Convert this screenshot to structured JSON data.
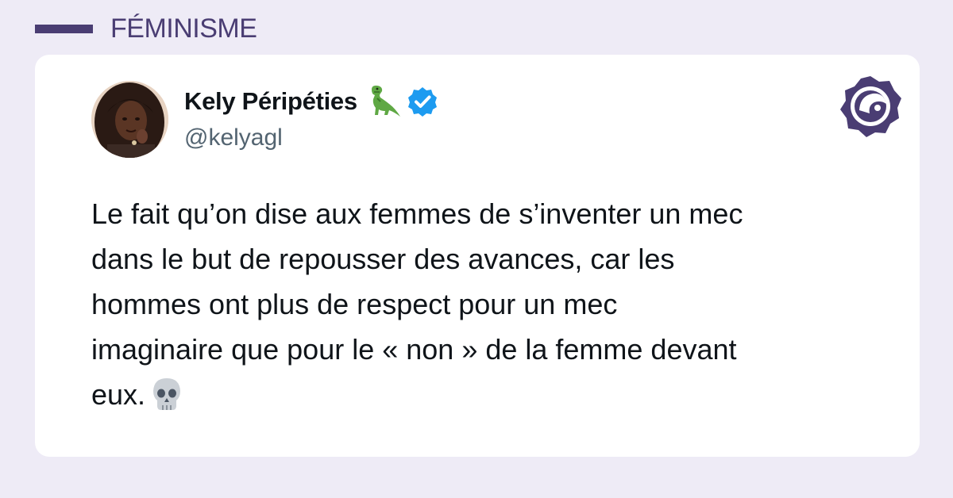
{
  "category": {
    "label": "FÉMINISME"
  },
  "tweet": {
    "author_name": "Kely Péripéties",
    "author_handle": "@kelyagl",
    "name_emoji": "t-rex-icon",
    "verified": true,
    "text": "Le fait qu’on dise aux femmes de s’inventer un mec\ndans le but de repousser des avances, car les\nhommes ont plus de respect pour un mec\nimaginaire que pour le « non » de la femme devant\neux.",
    "trailing_emoji": "skull-icon"
  },
  "brand": {
    "logo": "brand-logo-icon"
  },
  "colors": {
    "background": "#eeebf6",
    "accent": "#4a3d73",
    "card": "#ffffff",
    "verified_blue": "#1d9bf0",
    "text_primary": "#0f1419",
    "text_secondary": "#536471"
  }
}
